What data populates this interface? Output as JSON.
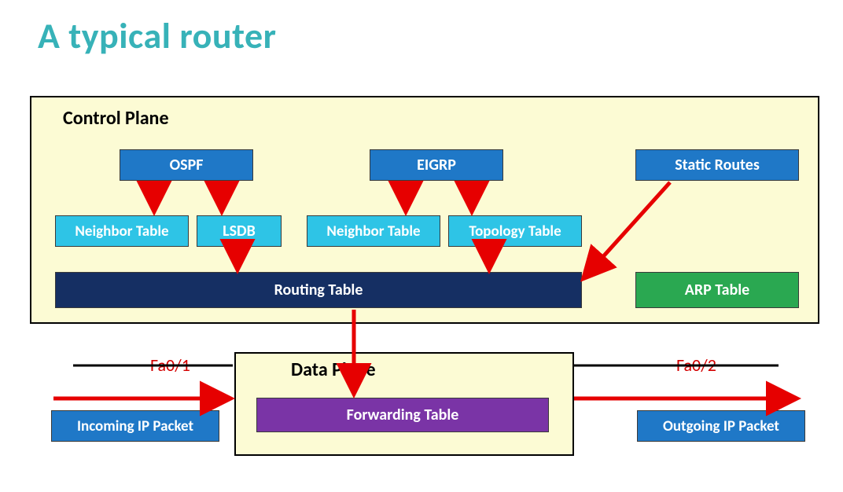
{
  "title": "A typical router",
  "control_plane": {
    "label": "Control Plane",
    "protocols": {
      "ospf": {
        "label": "OSPF",
        "sub1": "Neighbor Table",
        "sub2": "LSDB"
      },
      "eigrp": {
        "label": "EIGRP",
        "sub1": "Neighbor Table",
        "sub2": "Topology Table"
      },
      "static": {
        "label": "Static Routes"
      }
    },
    "routing_table": "Routing Table",
    "arp_table": "ARP Table"
  },
  "data_plane": {
    "label": "Data Plane",
    "forwarding_table": "Forwarding Table"
  },
  "interfaces": {
    "in": "Fa0/1",
    "out": "Fa0/2"
  },
  "packets": {
    "in": "Incoming IP Packet",
    "out": "Outgoing IP Packet"
  }
}
